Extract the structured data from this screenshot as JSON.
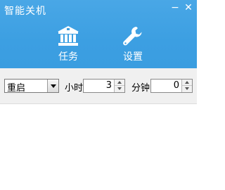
{
  "window": {
    "title": "智能关机",
    "minimize_glyph": "−",
    "close_glyph": "✕"
  },
  "nav": {
    "tasks": {
      "label": "任务",
      "icon": "bank-icon"
    },
    "settings": {
      "label": "设置",
      "icon": "wrench-icon"
    }
  },
  "controls": {
    "action_select": {
      "value": "重启"
    },
    "hours": {
      "label": "小时",
      "value": "3"
    },
    "minutes": {
      "label": "分钟",
      "value": "0"
    }
  },
  "colors": {
    "header": "#3c9fe2",
    "control_bar": "#f0f0f0"
  }
}
